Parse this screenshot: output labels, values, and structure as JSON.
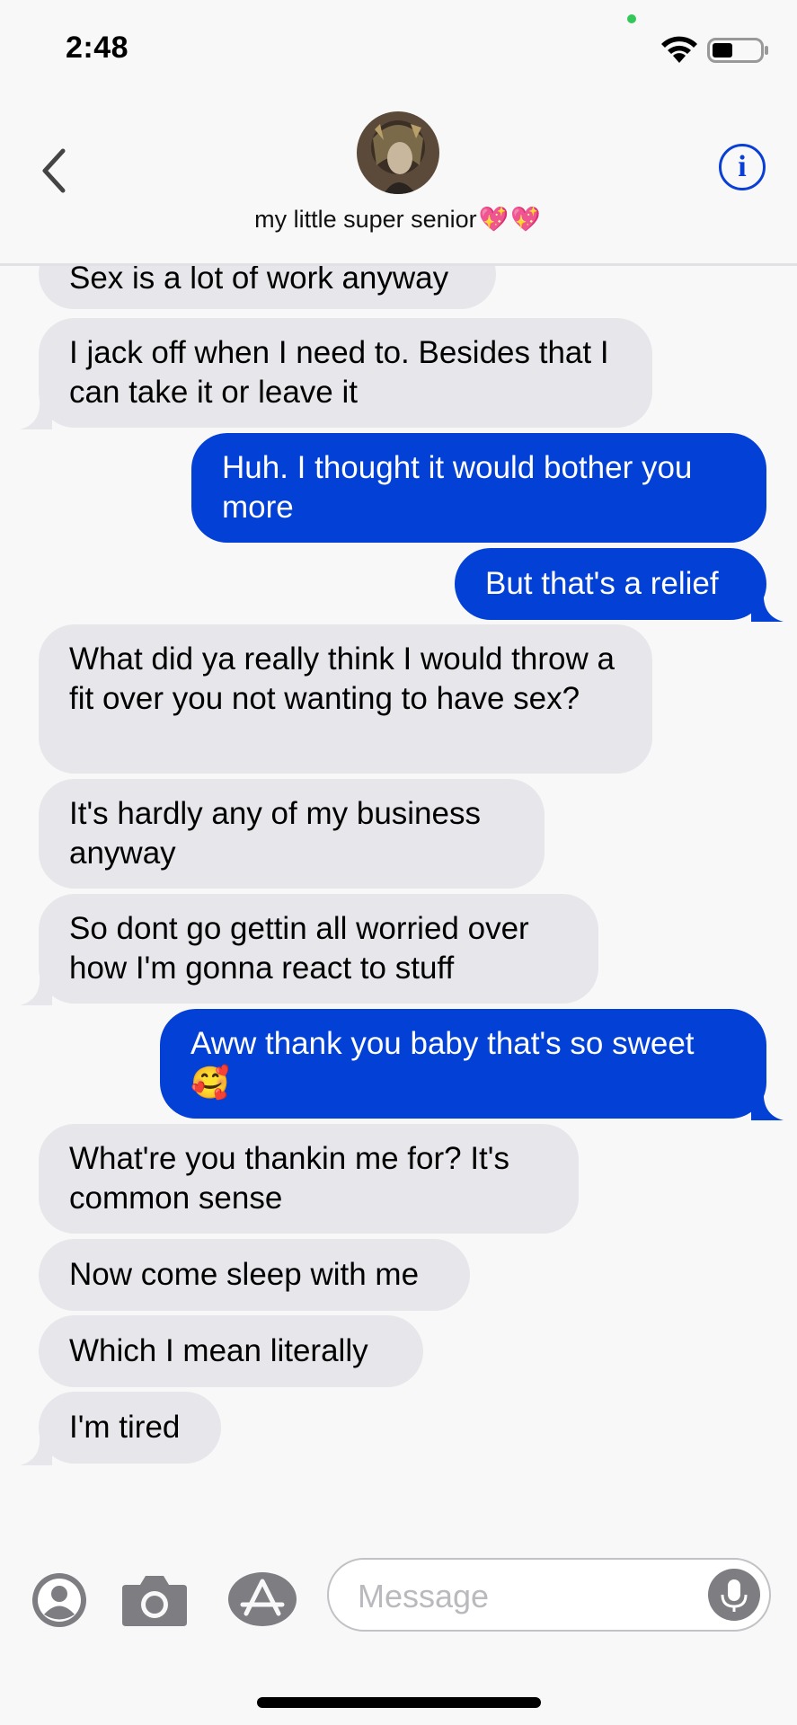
{
  "status_bar": {
    "time": "2:48"
  },
  "header": {
    "contact_name": "my little super senior",
    "contact_emoji": "💖💖",
    "info_label": "i"
  },
  "messages": [
    {
      "sender": "them",
      "text": "Sex is a lot of work anyway"
    },
    {
      "sender": "them",
      "text": "I jack off when I need to. Besides that I can take it or leave it"
    },
    {
      "sender": "me",
      "text": "Huh. I thought it would bother you more"
    },
    {
      "sender": "me",
      "text": "But that's a relief"
    },
    {
      "sender": "them",
      "text": "What did ya really think I would throw a fit over you not wanting to have sex?"
    },
    {
      "sender": "them",
      "text": "It's hardly any of my business anyway"
    },
    {
      "sender": "them",
      "text": "So dont go gettin all worried over how I'm gonna react to stuff"
    },
    {
      "sender": "me",
      "text": "Aww thank you baby that's so sweet 🥰"
    },
    {
      "sender": "them",
      "text": "What're you thankin me for? It's common sense"
    },
    {
      "sender": "them",
      "text": "Now come sleep with me"
    },
    {
      "sender": "them",
      "text": "Which I mean literally"
    },
    {
      "sender": "them",
      "text": "I'm tired"
    }
  ],
  "composer": {
    "placeholder": "Message"
  },
  "colors": {
    "outgoing_bubble": "#0340d6",
    "incoming_bubble": "#e7e6eb",
    "accent": "#0a3fd6"
  }
}
